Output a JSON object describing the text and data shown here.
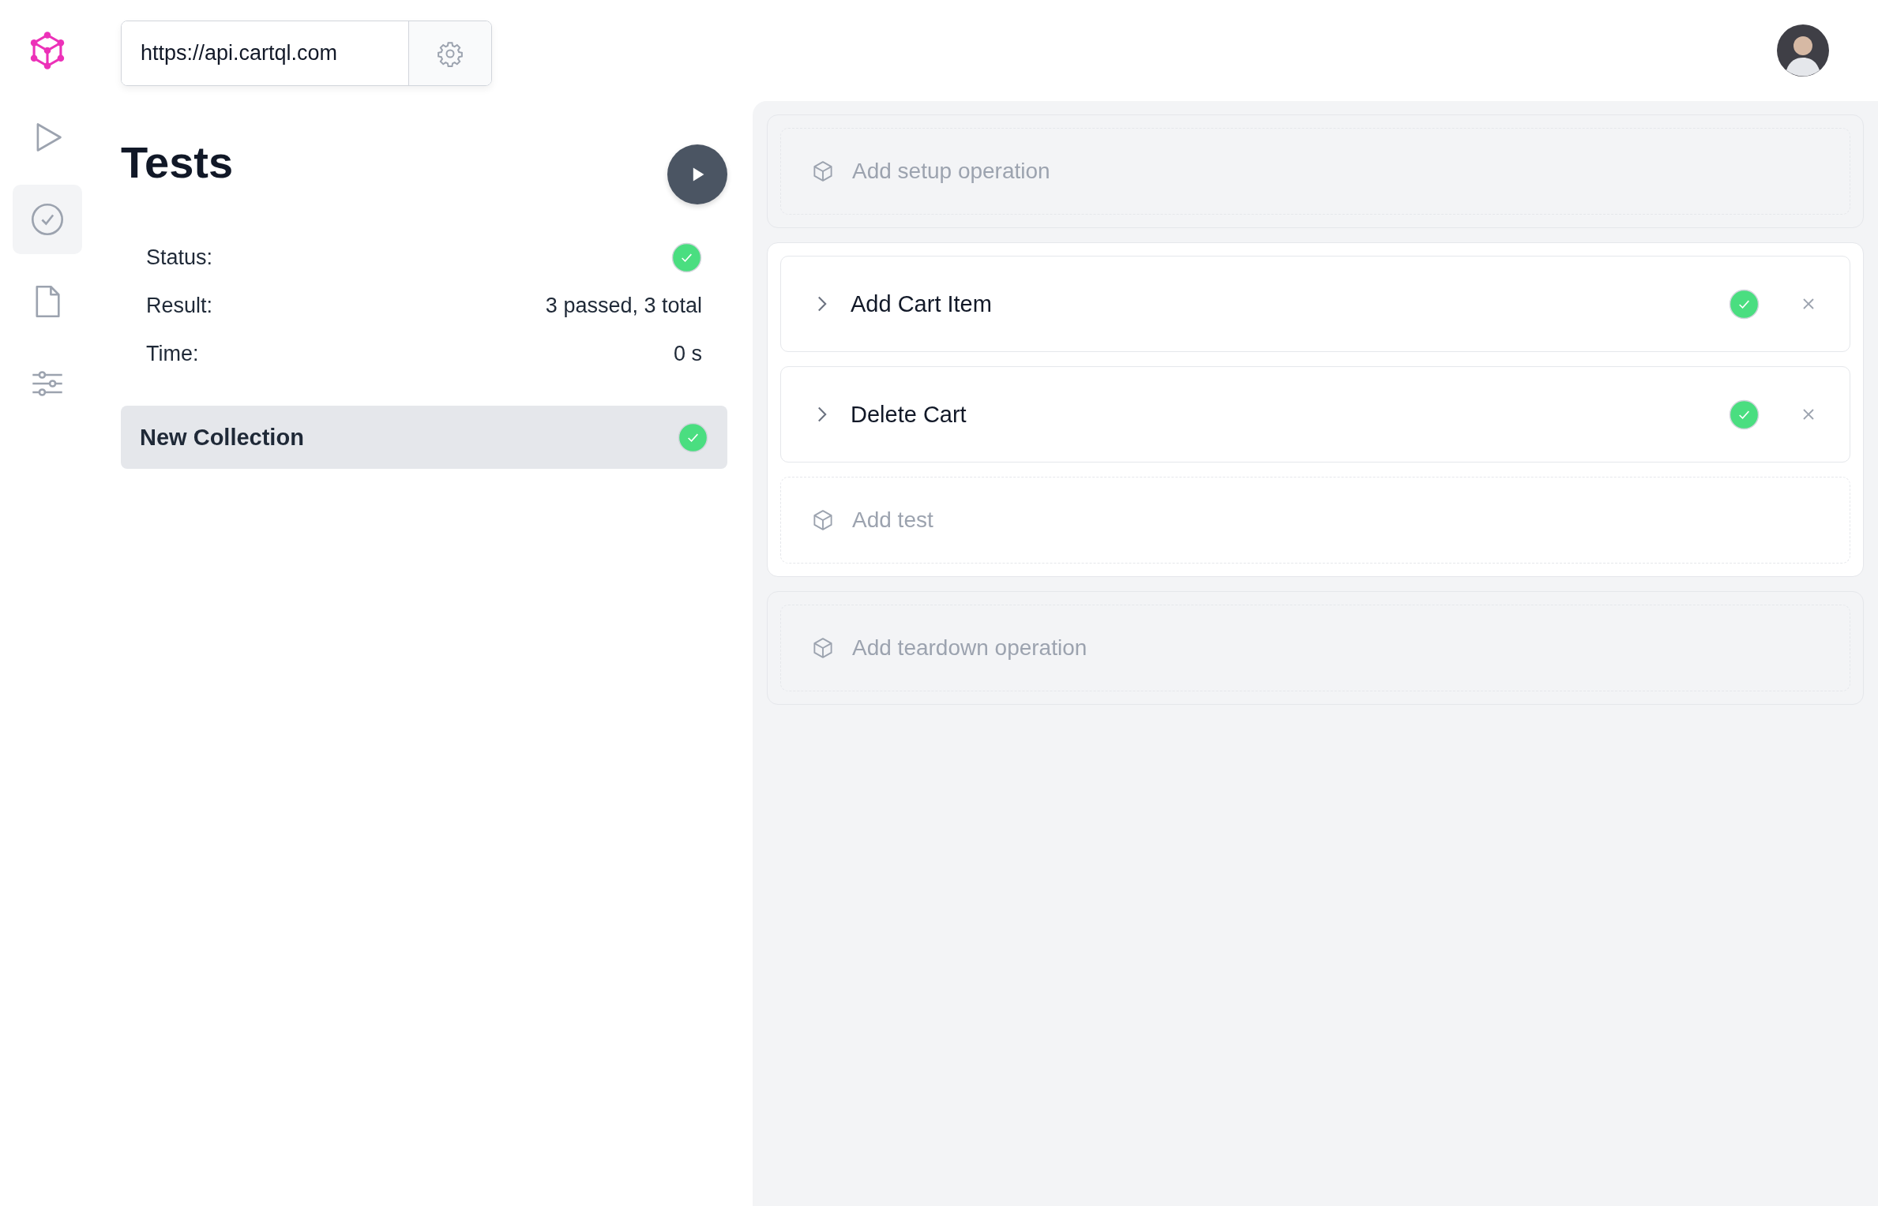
{
  "endpoint": {
    "url": "https://api.cartql.com"
  },
  "nav": [
    {
      "kind": "run",
      "selected": false
    },
    {
      "kind": "tests",
      "selected": true
    },
    {
      "kind": "docs",
      "selected": false
    },
    {
      "kind": "settings",
      "selected": false
    }
  ],
  "title": "Tests",
  "summary": [
    {
      "label": "Status:",
      "kind": "status",
      "passed": true
    },
    {
      "label": "Result:",
      "kind": "text",
      "value": "3 passed, 3 total"
    },
    {
      "label": "Time:",
      "kind": "text",
      "value": "0 s"
    }
  ],
  "collections": [
    {
      "name": "New Collection",
      "passed": true,
      "selected": true
    }
  ],
  "setup": {
    "placeholder": "Add setup operation"
  },
  "tests": [
    {
      "name": "Add Cart Item",
      "passed": true,
      "expanded": false
    },
    {
      "name": "Delete Cart",
      "passed": true,
      "expanded": false
    }
  ],
  "add_test": {
    "placeholder": "Add test"
  },
  "teardown": {
    "placeholder": "Add teardown operation"
  }
}
